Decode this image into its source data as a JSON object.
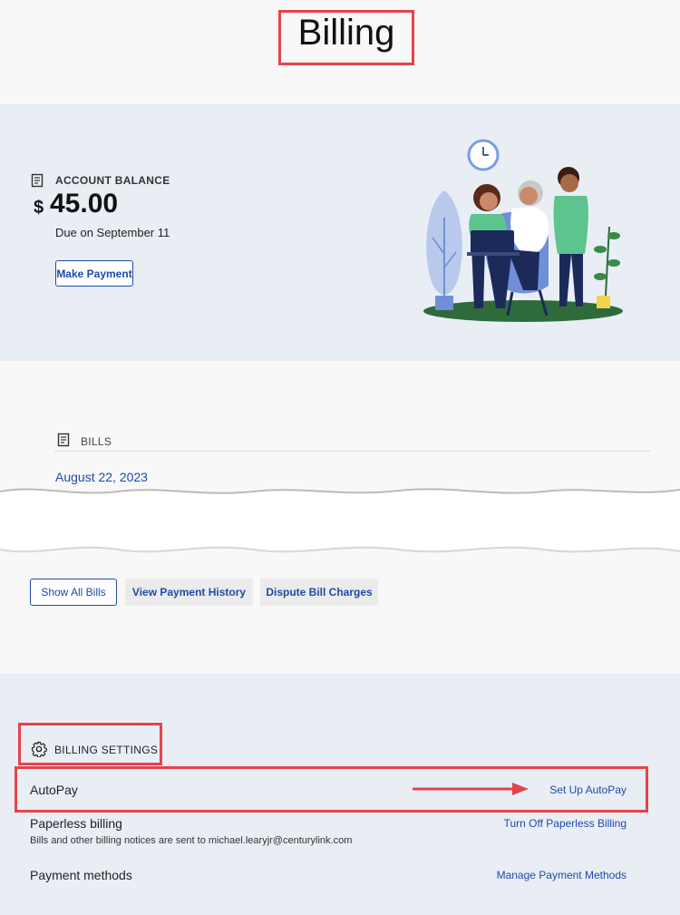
{
  "page": {
    "title": "Billing"
  },
  "balance": {
    "section_label": "ACCOUNT BALANCE",
    "currency": "$",
    "amount": "45.00",
    "due_text": "Due on September 11",
    "make_payment_label": "Make Payment"
  },
  "bills": {
    "section_label": "BILLS",
    "latest_date": "August 22, 2023",
    "actions": {
      "show_all": "Show All Bills",
      "view_history": "View Payment History",
      "dispute": "Dispute Bill Charges"
    }
  },
  "settings": {
    "section_label": "BILLING SETTINGS",
    "autopay": {
      "title": "AutoPay",
      "action": "Set Up AutoPay"
    },
    "paperless": {
      "title": "Paperless billing",
      "description": "Bills and other billing notices are sent to michael.learyjr@centurylink.com",
      "action": "Turn Off Paperless Billing"
    },
    "payment_methods": {
      "title": "Payment methods",
      "action": "Manage Payment Methods"
    }
  },
  "colors": {
    "annotation_red": "#e5434b",
    "link_blue": "#1f4aa8",
    "section_bg": "#e9eef5",
    "page_bg": "#f8f8f8"
  }
}
